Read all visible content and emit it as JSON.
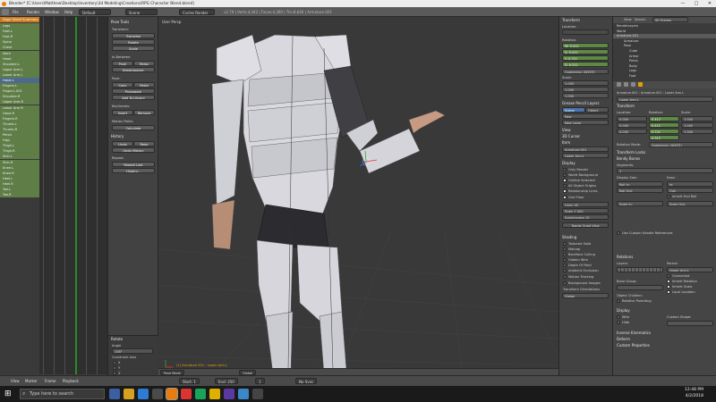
{
  "titlebar": {
    "title": "Blender* [C:\\Users\\Matthew\\Desktop\\Inventory\\3d Modeling\\Creations\\RPG Character Blend.blend]",
    "min": "—",
    "max": "□",
    "close": "✕"
  },
  "menu": {
    "items": [
      "File",
      "Render",
      "Window",
      "Help"
    ],
    "layout": "Default",
    "scene": "Scene",
    "engine": "Cycles Render",
    "info": "v2.79 | Verts:4,342 | Faces:4,360 | Tris:8,640 | Armature.001"
  },
  "dopesheet": {
    "header": "Dope Sheet Summary",
    "rows": [
      "Legs",
      "Foot.L",
      "Foot.R",
      "Spine",
      "Chest",
      "Neck",
      "Head",
      "Shoulder.L",
      "Upper Arm.L",
      "Lower Arm.L",
      "Hand.L",
      "Fingers.L",
      "Finger.L.001",
      "Shoulder.R",
      "Upper Arm.R",
      "Lower Arm.R",
      "Hand.R",
      "Fingers.R",
      "Thumb.L",
      "Thumb.R",
      "Pelvis",
      "Hips",
      "Thigh.L",
      "Thigh.R",
      "Shin.L",
      "Shin.R",
      "Knee.L",
      "Knee.R",
      "Heel.L",
      "Heel.R",
      "Toe.L",
      "Toe.R"
    ]
  },
  "tools": {
    "header": "Pose Tools",
    "transform": "Transform:",
    "translate": "Translate",
    "rotate": "Rotate",
    "scale": "Scale",
    "in_between": "In-Between:",
    "push": "Push",
    "relax": "Relax",
    "breakdowner": "Breakdowner",
    "pose": "Pose:",
    "copy": "Copy",
    "paste": "Paste",
    "propagate": "Propagate",
    "add_library": "Add To Library",
    "keyframes": "Keyframes:",
    "insert": "Insert",
    "remove": "Remove",
    "motion_paths": "Motion Paths:",
    "calculate": "Calculate",
    "history": "History",
    "undo": "Undo",
    "redo": "Redo",
    "undo_history": "Undo History",
    "repeat": "Repeat:",
    "repeat_last": "Repeat Last",
    "history2": "History...",
    "rotate_panel": "Rotate",
    "angle_label": "Angle",
    "angle": "158°",
    "constraint_axis": "Constraint Axis",
    "x": "X",
    "y": "Y",
    "z": "Z",
    "orientation": "Orientation",
    "orient_val": "Global"
  },
  "viewport": {
    "label": "User Persp",
    "status": "(1) Armature.001 : Lower Arm.L",
    "mode": "Pose Mode",
    "pivot": "Global"
  },
  "transform": {
    "header": "Transform",
    "location": "Location:",
    "rotation": "Rotation:",
    "w": "W:",
    "x": "X:",
    "y": "Y:",
    "z": "Z:",
    "wval": "0.412",
    "xval": "0.412",
    "yval": "0.721",
    "zval": "0.312",
    "mode": "Quaternion (WXYZ)",
    "scale": "Scale:",
    "s1": "1.000",
    "s2": "1.000",
    "s3": "1.000"
  },
  "gpencil": {
    "header": "Grease Pencil Layers",
    "scene": "Scene",
    "object": "Object",
    "new": "New",
    "new_layer": "New Layer"
  },
  "view": {
    "view": "View",
    "cursor": "3D Cursor",
    "item": "Item",
    "obj": "Armature.001",
    "bone": "Lower Arm.L"
  },
  "display": {
    "header": "Display",
    "only_render": "Only Render",
    "world_bg": "World Background",
    "outline": "Outline Selected",
    "all_origins": "All Object Origins",
    "relationship": "Relationship Lines",
    "grid_floor": "Grid Floor",
    "x": "X",
    "y": "Y",
    "z": "Z",
    "lines": "Lines",
    "lines_val": "16",
    "scale": "Scale",
    "scale_val": "1.000",
    "subdiv": "Subdivisions",
    "subdiv_val": "10",
    "toggle": "Toggle Quad View"
  },
  "shading": {
    "header": "Shading",
    "textured": "Textured Solid",
    "matcap": "Matcap",
    "backface": "Backface Culling",
    "hidden": "Hidden Wire",
    "dof": "Depth Of Field",
    "ao": "Ambient Occlusion",
    "motion": "Motion Tracking",
    "bg": "Background Images",
    "orient": "Transform Orientations",
    "global": "Global"
  },
  "outliner": {
    "view": "View",
    "search": "Search",
    "all_scenes": "All Scenes",
    "rows": [
      "RenderLayers",
      "World",
      "Armature.001",
      "Armature",
      "Pose",
      "Cube",
      "Armor",
      "Pelvis",
      "Body",
      "Legs",
      "Foot"
    ]
  },
  "bone": {
    "name": "Lower Arm.L",
    "breadcrumb": "Armature.001 › Armature.001 › Lower Arm.L",
    "transform": "Transform",
    "location": "Location:",
    "rotation": "Rotation:",
    "scale": "Scale:",
    "x": "0.000",
    "y": "0.000",
    "z": "0.000",
    "rw": "0.412",
    "rx": "0.412",
    "ry": "0.721",
    "rz": "0.312",
    "s": "1.000",
    "rot_mode": "Rotation Mode:",
    "quat": "Quaternion (WXYZ)",
    "locks": "Transform Locks",
    "bendy": "Bendy Bones",
    "segments": "Segments:",
    "seg_val": "1",
    "display_size": "Display Size:",
    "ease": "Ease:",
    "in": "In:",
    "out": "Out:",
    "roll": "Roll:",
    "roll_in": "Roll In:",
    "roll_out": "Roll Out:",
    "inherit_end": "Inherit End Roll",
    "scale_in": "Scale In:",
    "scale_out": "Scale Out:",
    "use_custom": "Use Custom Handle References",
    "relations": "Relations",
    "layers": "Layers:",
    "parent": "Parent:",
    "parent_val": "Upper Arm.L",
    "connected": "Connected",
    "inherit_rot": "Inherit Rotation",
    "inherit_scale": "Inherit Scale",
    "local_loc": "Local Location",
    "bone_group": "Bone Group:",
    "object_children": "Object Children:",
    "relative_parenting": "Relative Parenting",
    "display": "Display",
    "wire": "Wire",
    "hide": "Hide",
    "custom_shape": "Custom Shape:",
    "inverse_kin": "Inverse Kinematics",
    "deform": "Deform",
    "custom_props": "Custom Properties"
  },
  "timeline": {
    "view": "View",
    "marker": "Marker",
    "frame": "Frame",
    "playback": "Playback",
    "start": "Start: 1",
    "end": "End: 250",
    "current": "1",
    "no_sync": "No Sync"
  },
  "taskbar": {
    "search": "Type here to search",
    "time": "12:48 PM",
    "date": "4/2/2018"
  },
  "colors": {
    "green": "#5f7d47",
    "orange": "#cc7a1e",
    "blue": "#4a74b0"
  }
}
